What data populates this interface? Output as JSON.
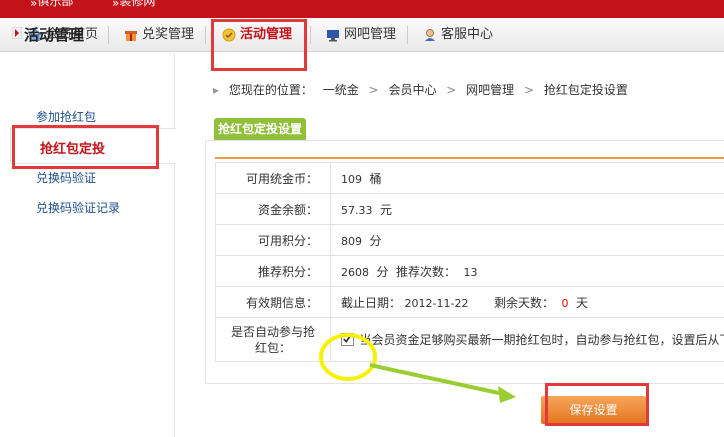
{
  "topbar": {
    "items": [
      "俱乐部",
      "装修网"
    ]
  },
  "nav": {
    "items": [
      {
        "label": "会员首页",
        "icon": "home-icon"
      },
      {
        "label": "兑奖管理",
        "icon": "gift-icon"
      },
      {
        "label": "活动管理",
        "icon": "activity-icon",
        "active": true
      },
      {
        "label": "网吧管理",
        "icon": "monitor-icon"
      },
      {
        "label": "客服中心",
        "icon": "support-icon"
      }
    ]
  },
  "sidebar": {
    "title": "活动管理",
    "links": [
      "参加抢红包",
      "抢红包定投",
      "兑换码验证",
      "兑换码验证记录"
    ]
  },
  "breadcrumb": {
    "prefix": "您现在的位置：",
    "items": [
      "一统金",
      "会员中心",
      "网吧管理",
      "抢红包定投设置"
    ],
    "sep": ">"
  },
  "section": {
    "title": "抢红包定投设置"
  },
  "form": {
    "coins_label": "可用统金币：",
    "coins_value": "109",
    "coins_unit": "桶",
    "balance_label": "资金余额：",
    "balance_value": "57.33",
    "balance_unit": "元",
    "points_label": "可用积分：",
    "points_value": "809",
    "points_unit": "分",
    "ref_label": "推荐积分：",
    "ref_value": "2608",
    "ref_unit": "分",
    "ref_count_label": "推荐次数：",
    "ref_count_value": "13",
    "expiry_label": "有效期信息：",
    "expiry_date_label": "截止日期：",
    "expiry_date": "2012-11-22",
    "remain_label": "剩余天数：",
    "remain_value": "0",
    "remain_unit": "天",
    "auto_label_1": "是否自动参与抢",
    "auto_label_2": "红包：",
    "auto_text": "当会员资金足够购买最新一期抢红包时，自动参与抢红包，设置后从下",
    "auto_checked": true
  },
  "buttons": {
    "save": "保存设置"
  },
  "colors": {
    "brand_red": "#c4121a",
    "highlight_red": "#e03a3a",
    "tab_green": "#8fbf3b",
    "orange": "#f19a45",
    "annotation_yellow": "#f5f10a",
    "annotation_green": "#9acd32"
  }
}
